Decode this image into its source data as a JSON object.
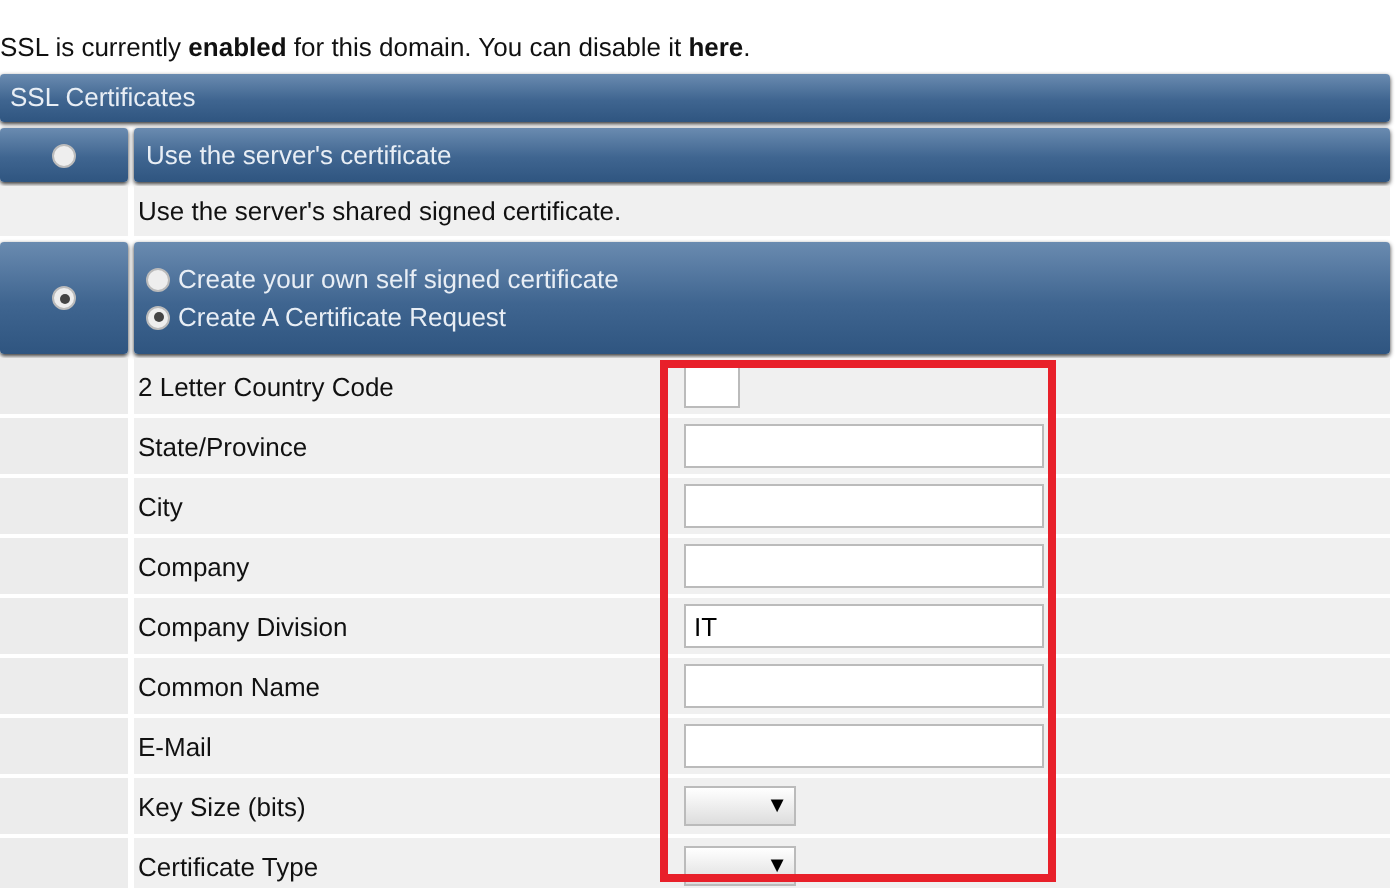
{
  "notice": "SSL is currently **enabled** for this domain. You can disable it **here**.",
  "section_title": "SSL Certificates",
  "options": [
    {
      "label": "Use the server's certificate",
      "selected": false,
      "description": "Use the server's shared signed certificate."
    },
    {
      "selected": true,
      "choices": [
        {
          "label": "Create your own self signed certificate",
          "selected": false
        },
        {
          "label": "Create A Certificate Request",
          "selected": true
        }
      ]
    }
  ],
  "fields": [
    {
      "kind": "short",
      "label": "2 Letter Country Code"
    },
    {
      "kind": "text",
      "label": "State/Province"
    },
    {
      "kind": "text",
      "label": "City"
    },
    {
      "kind": "text",
      "label": "Company"
    },
    {
      "kind": "text",
      "label": "Company Division",
      "value": "IT"
    },
    {
      "kind": "text",
      "label": "Common Name"
    },
    {
      "kind": "text",
      "label": "E-Mail"
    },
    {
      "kind": "select",
      "label": "Key Size (bits)",
      "arrow": "▼"
    },
    {
      "kind": "select",
      "label": "Certificate Type",
      "arrow": "▼"
    }
  ]
}
